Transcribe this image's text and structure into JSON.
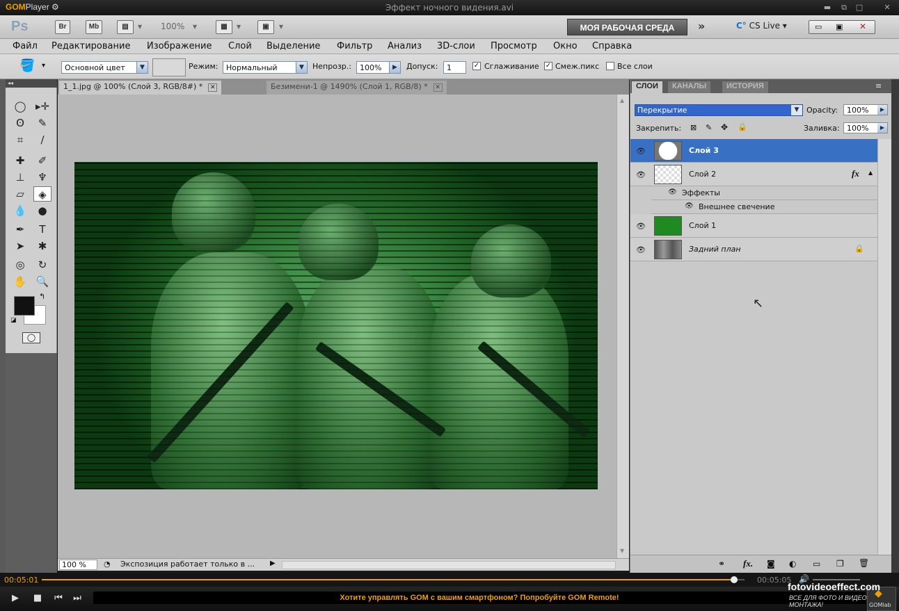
{
  "gom": {
    "logo": "GOM",
    "logo_suffix": "Player",
    "window_title": "Эффект ночного видения.avi",
    "time_current": "00:05:01",
    "time_total": "00:05:05",
    "progress": 0.985,
    "promo": "Хотите управлять GOM с вашим смартфоном? Попробуйте GOM Remote!",
    "badge": "GOMlab"
  },
  "watermark": {
    "site": "fotovideoeffect.com",
    "tagline": "ВСЕ ДЛЯ ФОТО И ВИДЕО МОНТАЖА!"
  },
  "appbar": {
    "logo": "Ps",
    "bridge": "Br",
    "minibridge": "Mb",
    "zoom": "100%",
    "workspace": "МОЯ РАБОЧАЯ СРЕДА",
    "cslive": "CS Live"
  },
  "menu": [
    "Файл",
    "Редактирование",
    "Изображение",
    "Слой",
    "Выделение",
    "Фильтр",
    "Анализ",
    "3D-слои",
    "Просмотр",
    "Окно",
    "Справка"
  ],
  "options": {
    "fill_source": "Основной цвет",
    "mode_label": "Режим:",
    "mode_value": "Нормальный",
    "opacity_label": "Непрозр.:",
    "opacity_value": "100%",
    "tolerance_label": "Допуск:",
    "tolerance_value": "1",
    "antialias_label": "Сглаживание",
    "contiguous_label": "Смеж.пикс",
    "all_layers_label": "Все слои"
  },
  "tabs": [
    {
      "label": "1_1.jpg @ 100% (Слой 3, RGB/8#) *"
    },
    {
      "label": "Безимени-1 @ 1490% (Слой 1, RGB/8) *"
    }
  ],
  "status": {
    "zoom": "100 %",
    "message": "Экспозиция работает только в ..."
  },
  "panel": {
    "tabs": [
      "СЛОИ",
      "КАНАЛЫ",
      "ИСТОРИЯ"
    ],
    "blend_mode": "Перекрытие",
    "opacity_label": "Opacity:",
    "opacity_value": "100%",
    "lock_label": "Закрепить:",
    "fill_label": "Заливка:",
    "fill_value": "100%",
    "layers": [
      {
        "name": "Слой 3"
      },
      {
        "name": "Слой 2",
        "fx": "fx"
      },
      {
        "name": "Эффекты"
      },
      {
        "name": "Внешнее свечение"
      },
      {
        "name": "Слой 1"
      },
      {
        "name": "Задний план"
      }
    ]
  },
  "colors": {
    "accent": "#f2a000",
    "selection": "#3870c4",
    "foreground": "#111111",
    "background": "#ffffff",
    "layer1_fill": "#1f8a22"
  }
}
